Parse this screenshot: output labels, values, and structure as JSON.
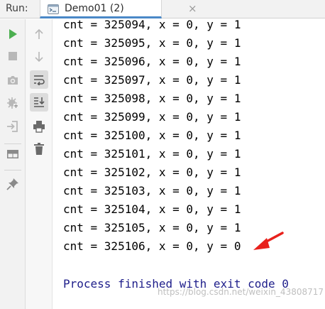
{
  "header": {
    "run_label": "Run:",
    "tab_title": "Demo01 (2)",
    "tab_close": "×"
  },
  "console": {
    "lines": [
      "cnt = 325094, x = 0, y = 1",
      "cnt = 325095, x = 0, y = 1",
      "cnt = 325096, x = 0, y = 1",
      "cnt = 325097, x = 0, y = 1",
      "cnt = 325098, x = 0, y = 1",
      "cnt = 325099, x = 0, y = 1",
      "cnt = 325100, x = 0, y = 1",
      "cnt = 325101, x = 0, y = 1",
      "cnt = 325102, x = 0, y = 1",
      "cnt = 325103, x = 0, y = 1",
      "cnt = 325104, x = 0, y = 1",
      "cnt = 325105, x = 0, y = 1",
      "cnt = 325106, x = 0, y = 0"
    ],
    "exit_message": "Process finished with exit code 0"
  },
  "toolbar": {
    "left_icons": [
      "run-icon",
      "stop-icon",
      "camera-icon",
      "debug-settings-icon",
      "login-icon",
      "layout-icon",
      "pin-icon"
    ],
    "right_icons": [
      "arrow-up-icon",
      "arrow-down-icon",
      "soft-wrap-icon",
      "scroll-to-end-icon",
      "print-icon",
      "trash-icon"
    ]
  },
  "watermark": "https://blog.csdn.net/weixin_43808717",
  "colors": {
    "run_green": "#4caf50",
    "exit_text": "#1d1d8a",
    "annotation_arrow": "#e8211c",
    "tab_underline": "#4a88c7"
  }
}
